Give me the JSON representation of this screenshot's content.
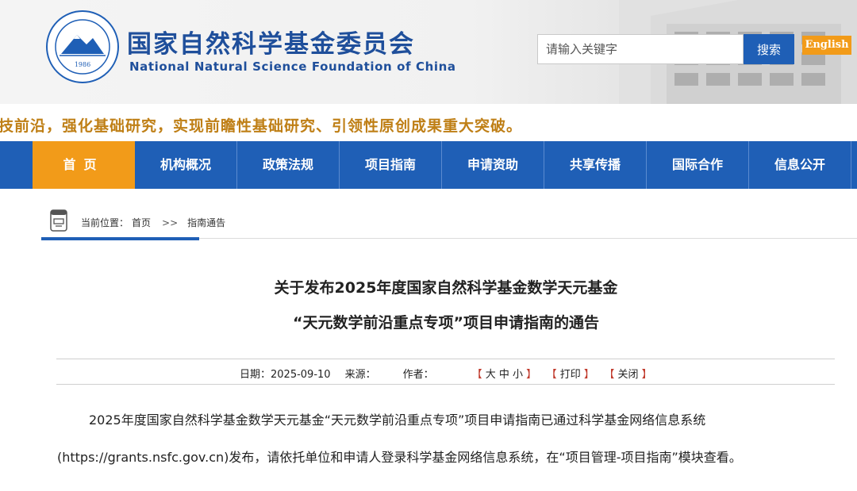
{
  "header": {
    "title_cn": "国家自然科学基金委员会",
    "title_en": "National Natural Science Foundation of China",
    "logo_year": "1986",
    "brand_color": "#1f5fb6",
    "accent_color": "#f29b19"
  },
  "search": {
    "placeholder": "请输入关键字",
    "button_label": "搜索"
  },
  "language_link": "English",
  "slogan": "技前沿，强化基础研究，实现前瞻性基础研究、引领性原创成果重大突破。",
  "nav": {
    "items": [
      {
        "label": "首页",
        "active": true
      },
      {
        "label": "机构概况"
      },
      {
        "label": "政策法规"
      },
      {
        "label": "项目指南"
      },
      {
        "label": "申请资助"
      },
      {
        "label": "共享传播"
      },
      {
        "label": "国际合作"
      },
      {
        "label": "信息公开"
      }
    ]
  },
  "breadcrumb": {
    "prefix": "当前位置：",
    "home": "首页",
    "separator": ">>",
    "current": "指南通告"
  },
  "article": {
    "title_line1": "关于发布2025年度国家自然科学基金数学天元基金",
    "title_line2": "“天元数学前沿重点专项”项目申请指南的通告",
    "date_label": "日期：",
    "date": "2025-09-10",
    "source_label": "来源：",
    "author_label": "作者：",
    "font_size_label": "大 中 小",
    "print_label": "打印",
    "close_label": "关闭",
    "paragraph_line1": "2025年度国家自然科学基金数学天元基金“天元数学前沿重点专项”项目申请指南已通过科学基金网络信息系统",
    "paragraph_line2": "(https://grants.nsfc.gov.cn)发布，请依托单位和申请人登录科学基金网络信息系统，在“项目管理-项目指南”模块查看。"
  }
}
